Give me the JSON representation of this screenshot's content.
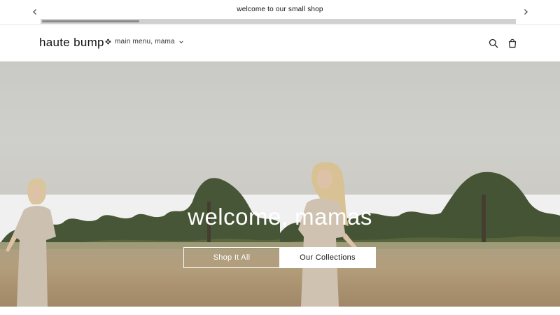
{
  "announcement": {
    "text": "welcome to our small shop",
    "prev_icon": "chevron-left-icon",
    "next_icon": "chevron-right-icon",
    "scroll_position": 0.2
  },
  "header": {
    "logo": "haute bump",
    "menu_label": "main menu, mama",
    "menu_icon": "flower-icon",
    "search_icon": "search-icon",
    "cart_icon": "cart-icon"
  },
  "hero": {
    "title": "welcome, mamas",
    "primary_button": "Shop It All",
    "secondary_button": "Our Collections"
  },
  "colors": {
    "text": "#121212",
    "background": "#ffffff",
    "button_text_light": "#ffffff"
  }
}
